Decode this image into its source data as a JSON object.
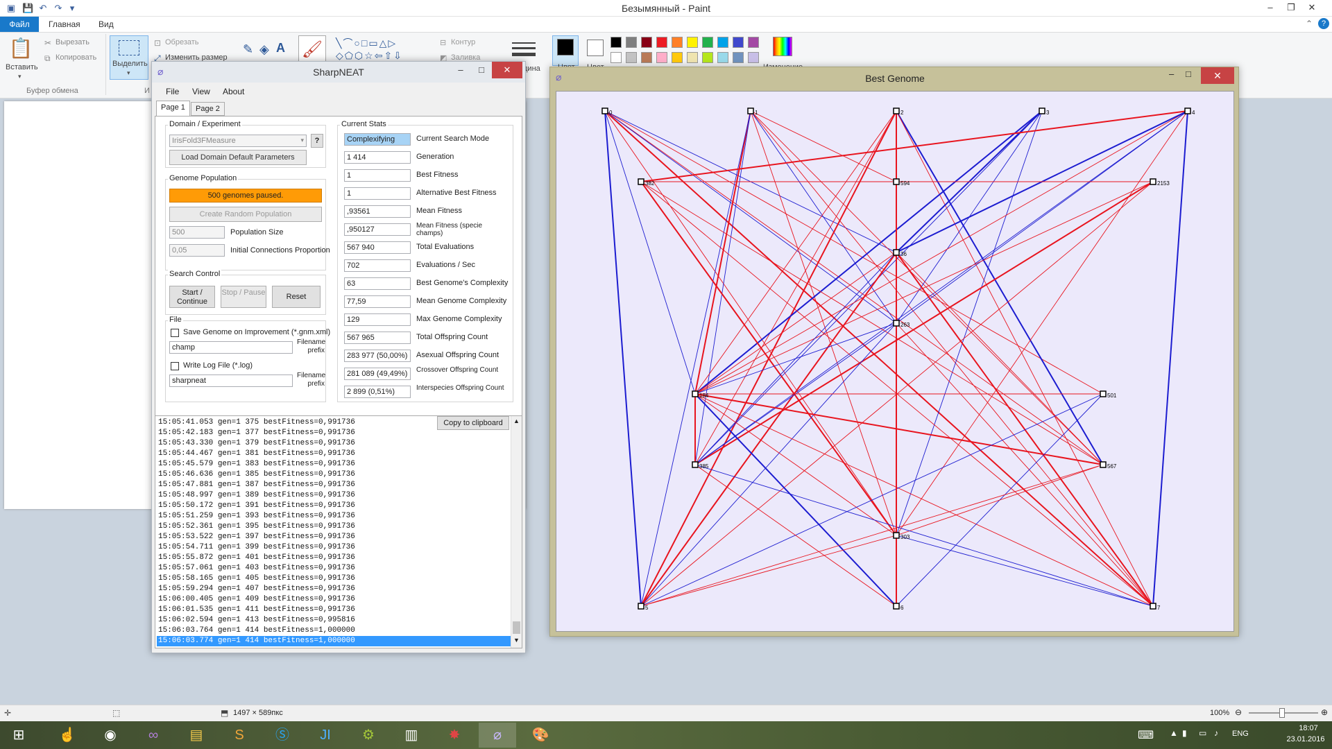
{
  "paint": {
    "title": "Безымянный - Paint",
    "tabs": [
      "Файл",
      "Главная",
      "Вид"
    ],
    "clipboard": {
      "paste": "Вставить",
      "cut": "Вырезать",
      "copy": "Копировать",
      "group": "Буфер обмена"
    },
    "image": {
      "select": "Выделить",
      "crop": "Обрезать",
      "resize": "Изменить размер",
      "group_short": "И"
    },
    "shapes": {
      "outline": "Контур",
      "fill": "Заливка"
    },
    "colors": {
      "color1": "Цвет",
      "color2": "Цвет",
      "edit": "Изменение",
      "size_short": "дина"
    },
    "palette": [
      "#000000",
      "#7f7f7f",
      "#880015",
      "#ed1c24",
      "#ff7f27",
      "#fff200",
      "#22b14c",
      "#00a2e8",
      "#3f48cc",
      "#a349a4",
      "#ffffff",
      "#c3c3c3",
      "#b97a57",
      "#ffaec9",
      "#ffc90e",
      "#efe4b0",
      "#b5e61d",
      "#99d9ea",
      "#7092be",
      "#c8bfe7"
    ],
    "status": {
      "dimensions": "1497 × 589пкс",
      "zoom": "100%"
    }
  },
  "sharpneat": {
    "title": "SharpNEAT",
    "menu": [
      "File",
      "View",
      "About"
    ],
    "tabs": [
      "Page 1",
      "Page 2"
    ],
    "domain": {
      "title": "Domain / Experiment",
      "experiment": "IrisFold3FMeasure",
      "help": "?",
      "load_defaults": "Load Domain Default Parameters"
    },
    "population": {
      "title": "Genome Population",
      "status": "500 genomes paused.",
      "create_random": "Create Random Population",
      "size_value": "500",
      "size_label": "Population Size",
      "conn_value": "0,05",
      "conn_label": "Initial Connections Proportion"
    },
    "search": {
      "title": "Search Control",
      "start": "Start / Continue",
      "stop": "Stop / Pause",
      "reset": "Reset"
    },
    "file": {
      "title": "File",
      "save_genome": "Save Genome on Improvement (*.gnm.xml)",
      "champ_value": "champ",
      "prefix_label": "Filename prefix",
      "write_log": "Write Log File (*.log)",
      "log_value": "sharpneat",
      "prefix_label2": "Filename prefix"
    },
    "stats": {
      "title": "Current Stats",
      "rows": [
        {
          "value": "Complexifying",
          "label": "Current Search Mode"
        },
        {
          "value": "1 414",
          "label": "Generation"
        },
        {
          "value": "1",
          "label": "Best Fitness"
        },
        {
          "value": "1",
          "label": "Alternative Best Fitness"
        },
        {
          "value": ",93561",
          "label": "Mean Fitness"
        },
        {
          "value": ",950127",
          "label": "Mean Fitness (specie champs)"
        },
        {
          "value": "567 940",
          "label": "Total Evaluations"
        },
        {
          "value": "702",
          "label": "Evaluations / Sec"
        },
        {
          "value": "63",
          "label": "Best Genome's Complexity"
        },
        {
          "value": "77,59",
          "label": "Mean Genome Complexity"
        },
        {
          "value": "129",
          "label": "Max Genome Complexity"
        },
        {
          "value": "567 965",
          "label": "Total Offspring Count"
        },
        {
          "value": "283 977 (50,00%)",
          "label": "Asexual Offspring Count"
        },
        {
          "value": "281 089 (49,49%)",
          "label": "Crossover Offspring Count"
        },
        {
          "value": "2 899 (0,51%)",
          "label": "Interspecies Offspring Count"
        }
      ]
    },
    "log": {
      "copy": "Copy to clipboard",
      "lines": [
        "15:05:41.053 gen=1 375 bestFitness=0,991736",
        "15:05:42.183 gen=1 377 bestFitness=0,991736",
        "15:05:43.330 gen=1 379 bestFitness=0,991736",
        "15:05:44.467 gen=1 381 bestFitness=0,991736",
        "15:05:45.579 gen=1 383 bestFitness=0,991736",
        "15:05:46.636 gen=1 385 bestFitness=0,991736",
        "15:05:47.881 gen=1 387 bestFitness=0,991736",
        "15:05:48.997 gen=1 389 bestFitness=0,991736",
        "15:05:50.172 gen=1 391 bestFitness=0,991736",
        "15:05:51.259 gen=1 393 bestFitness=0,991736",
        "15:05:52.361 gen=1 395 bestFitness=0,991736",
        "15:05:53.522 gen=1 397 bestFitness=0,991736",
        "15:05:54.711 gen=1 399 bestFitness=0,991736",
        "15:05:55.872 gen=1 401 bestFitness=0,991736",
        "15:05:57.061 gen=1 403 bestFitness=0,991736",
        "15:05:58.165 gen=1 405 bestFitness=0,991736",
        "15:05:59.294 gen=1 407 bestFitness=0,991736",
        "15:06:00.405 gen=1 409 bestFitness=0,991736",
        "15:06:01.535 gen=1 411 bestFitness=0,991736",
        "15:06:02.594 gen=1 413 bestFitness=0,995816",
        "15:06:03.764 gen=1 414 bestFitness=1,000000",
        "15:06:03.774 gen=1 414 bestFitness=1,000000"
      ]
    }
  },
  "best_genome": {
    "title": "Best Genome",
    "nodes": [
      "0",
      "1",
      "2",
      "3",
      "4",
      "382",
      "594",
      "2153",
      "36",
      "263",
      "184",
      "501",
      "385",
      "567",
      "303",
      "5",
      "6",
      "7"
    ],
    "connections": [
      [
        "0",
        "5",
        "blue",
        2
      ],
      [
        "0",
        "184",
        "blue",
        1
      ],
      [
        "0",
        "36",
        "blue",
        1
      ],
      [
        "0",
        "567",
        "red",
        1
      ],
      [
        "0",
        "7",
        "red",
        2
      ],
      [
        "0",
        "263",
        "blue",
        1
      ],
      [
        "0",
        "303",
        "red",
        1
      ],
      [
        "0",
        "501",
        "red",
        1
      ],
      [
        "1",
        "184",
        "red",
        2
      ],
      [
        "1",
        "567",
        "red",
        1
      ],
      [
        "1",
        "303",
        "red",
        1
      ],
      [
        "1",
        "7",
        "red",
        1
      ],
      [
        "1",
        "5",
        "blue",
        1
      ],
      [
        "1",
        "385",
        "blue",
        1
      ],
      [
        "1",
        "594",
        "red",
        1
      ],
      [
        "1",
        "263",
        "blue",
        1
      ],
      [
        "2",
        "6",
        "red",
        2
      ],
      [
        "2",
        "5",
        "red",
        2
      ],
      [
        "2",
        "567",
        "blue",
        2
      ],
      [
        "2",
        "184",
        "red",
        1
      ],
      [
        "2",
        "385",
        "red",
        1
      ],
      [
        "2",
        "7",
        "red",
        1
      ],
      [
        "3",
        "184",
        "blue",
        2
      ],
      [
        "3",
        "385",
        "blue",
        1
      ],
      [
        "3",
        "36",
        "blue",
        2
      ],
      [
        "3",
        "303",
        "blue",
        1
      ],
      [
        "3",
        "263",
        "blue",
        1
      ],
      [
        "4",
        "382",
        "red",
        2
      ],
      [
        "4",
        "7",
        "blue",
        2
      ],
      [
        "4",
        "184",
        "red",
        1
      ],
      [
        "4",
        "385",
        "blue",
        1
      ],
      [
        "4",
        "36",
        "blue",
        2
      ],
      [
        "4",
        "303",
        "red",
        1
      ],
      [
        "4",
        "263",
        "blue",
        1
      ],
      [
        "382",
        "303",
        "red",
        2
      ],
      [
        "382",
        "7",
        "red",
        1
      ],
      [
        "382",
        "567",
        "red",
        1
      ],
      [
        "382",
        "2153",
        "red",
        1
      ],
      [
        "2153",
        "385",
        "red",
        2
      ],
      [
        "2153",
        "184",
        "red",
        1
      ],
      [
        "2153",
        "5",
        "red",
        1
      ],
      [
        "36",
        "184",
        "red",
        1
      ],
      [
        "36",
        "5",
        "red",
        2
      ],
      [
        "36",
        "7",
        "red",
        2
      ],
      [
        "36",
        "567",
        "red",
        1
      ],
      [
        "36",
        "385",
        "blue",
        1
      ],
      [
        "36",
        "303",
        "red",
        1
      ],
      [
        "263",
        "184",
        "blue",
        1
      ],
      [
        "263",
        "7",
        "red",
        1
      ],
      [
        "263",
        "5",
        "blue",
        1
      ],
      [
        "263",
        "385",
        "blue",
        1
      ],
      [
        "184",
        "567",
        "red",
        2
      ],
      [
        "184",
        "385",
        "red",
        2
      ],
      [
        "184",
        "6",
        "blue",
        2
      ],
      [
        "184",
        "7",
        "red",
        1
      ],
      [
        "184",
        "303",
        "red",
        1
      ],
      [
        "501",
        "6",
        "blue",
        1
      ],
      [
        "501",
        "184",
        "red",
        1
      ],
      [
        "501",
        "5",
        "blue",
        1
      ],
      [
        "567",
        "303",
        "red",
        1
      ],
      [
        "567",
        "5",
        "red",
        1
      ],
      [
        "385",
        "7",
        "blue",
        1
      ],
      [
        "385",
        "6",
        "red",
        1
      ],
      [
        "303",
        "5",
        "red",
        1
      ],
      [
        "303",
        "7",
        "blue",
        1
      ],
      [
        "594",
        "6",
        "red",
        2
      ],
      [
        "594",
        "263",
        "red",
        1
      ]
    ]
  },
  "taskbar": {
    "lang": "ENG",
    "time": "18:07",
    "date": "23.01.2016"
  }
}
